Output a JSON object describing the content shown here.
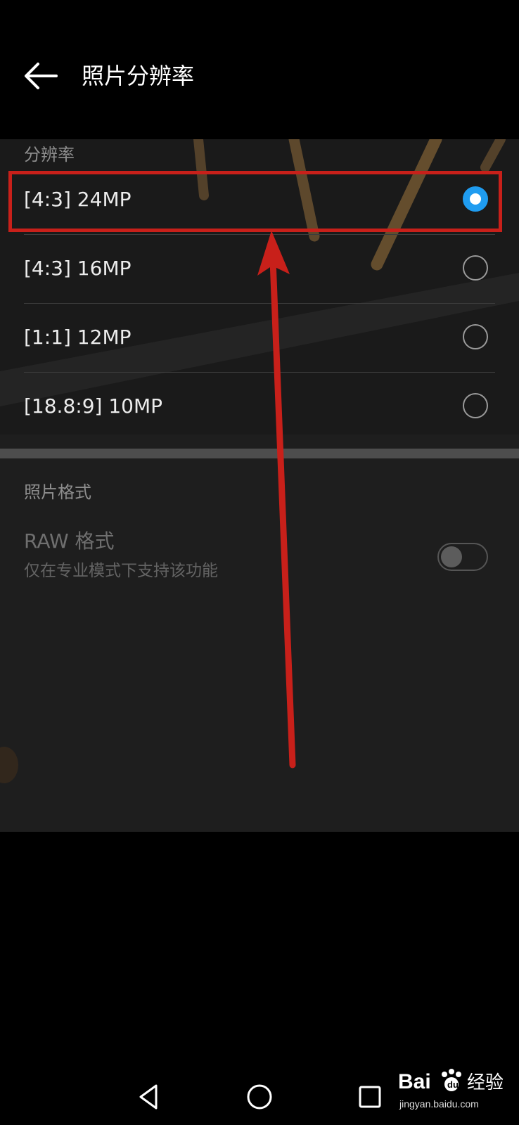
{
  "header": {
    "title": "照片分辨率"
  },
  "resolution_section": {
    "label": "分辨率",
    "options": [
      {
        "label": "[4:3] 24MP",
        "selected": true
      },
      {
        "label": "[4:3] 16MP",
        "selected": false
      },
      {
        "label": "[1:1] 12MP",
        "selected": false
      },
      {
        "label": "[18.8:9] 10MP",
        "selected": false
      }
    ]
  },
  "format_section": {
    "label": "照片格式",
    "raw": {
      "title": "RAW 格式",
      "description": "仅在专业模式下支持该功能",
      "enabled": false
    }
  },
  "watermark": {
    "brand": "Bai du 经验",
    "url": "jingyan.baidu.com"
  },
  "colors": {
    "selected": "#1f9cf0",
    "annotation": "#c8201a"
  }
}
